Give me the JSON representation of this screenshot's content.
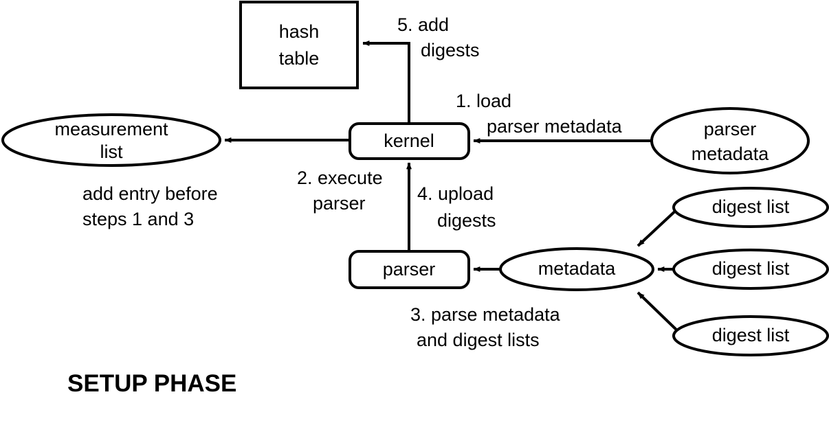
{
  "diagram": {
    "title": "SETUP PHASE",
    "stroke_color": "#000000",
    "fill_color": "#ffffff",
    "nodes": {
      "hash_table": {
        "line1": "hash",
        "line2": "table",
        "shape": "rectangle"
      },
      "kernel": {
        "label": "kernel",
        "shape": "rounded-rectangle"
      },
      "measurement_list": {
        "line1": "measurement",
        "line2": "list",
        "shape": "ellipse"
      },
      "parser_metadata": {
        "line1": "parser",
        "line2": "metadata",
        "shape": "ellipse"
      },
      "parser": {
        "label": "parser",
        "shape": "rounded-rectangle"
      },
      "metadata": {
        "label": "metadata",
        "shape": "ellipse"
      },
      "digest_list_1": {
        "label": "digest list",
        "shape": "ellipse"
      },
      "digest_list_2": {
        "label": "digest list",
        "shape": "ellipse"
      },
      "digest_list_3": {
        "label": "digest list",
        "shape": "ellipse"
      }
    },
    "edge_labels": {
      "step5": {
        "line1": "5. add",
        "line2": "digests"
      },
      "step1": {
        "line1": "1.  load",
        "line2": "parser metadata"
      },
      "step2": {
        "line1": "2. execute",
        "line2": "parser"
      },
      "step4": {
        "line1": "4. upload",
        "line2": "digests"
      },
      "step3": {
        "line1": "3. parse metadata",
        "line2": "and digest lists"
      },
      "measurement_note": {
        "line1": "add entry before",
        "line2": "steps 1 and 3"
      }
    }
  }
}
